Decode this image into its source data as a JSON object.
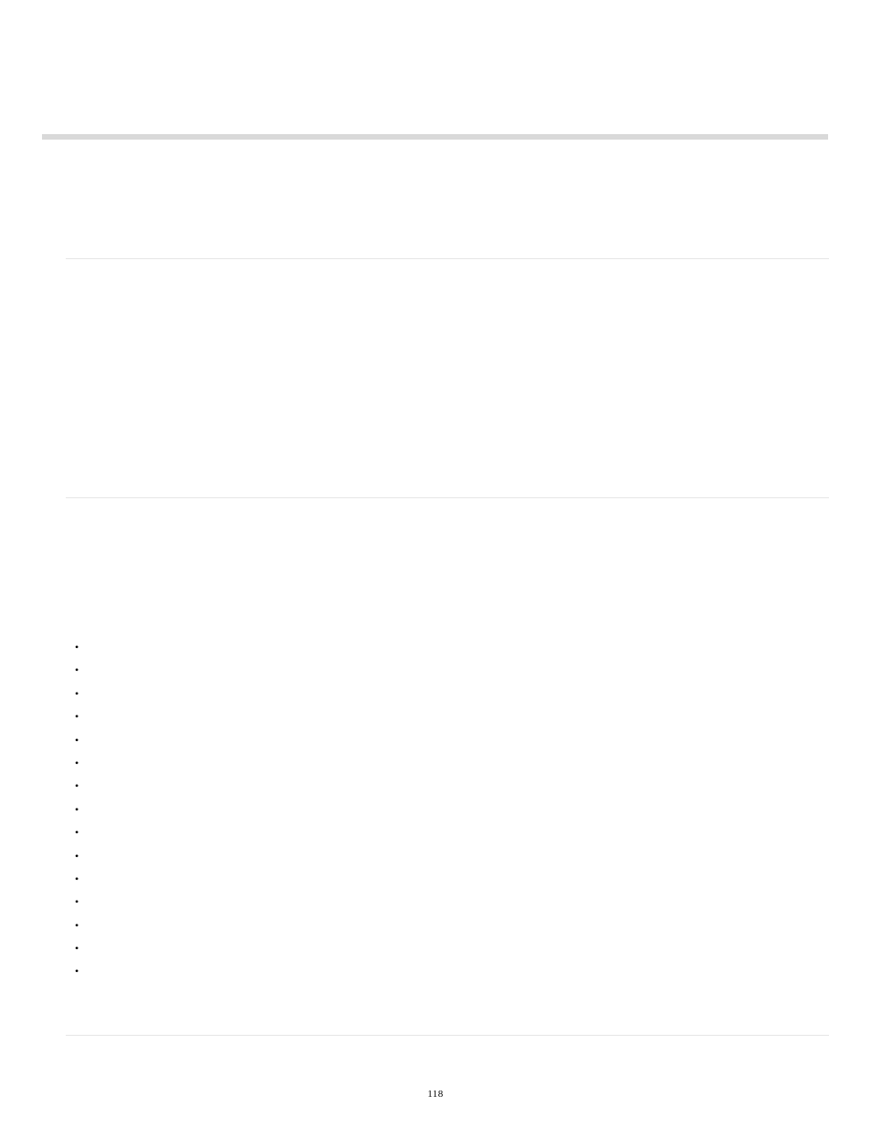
{
  "page_number": "118",
  "bullets": [
    "",
    "",
    "",
    "",
    "",
    "",
    "",
    "",
    "",
    "",
    "",
    "",
    "",
    "",
    ""
  ]
}
